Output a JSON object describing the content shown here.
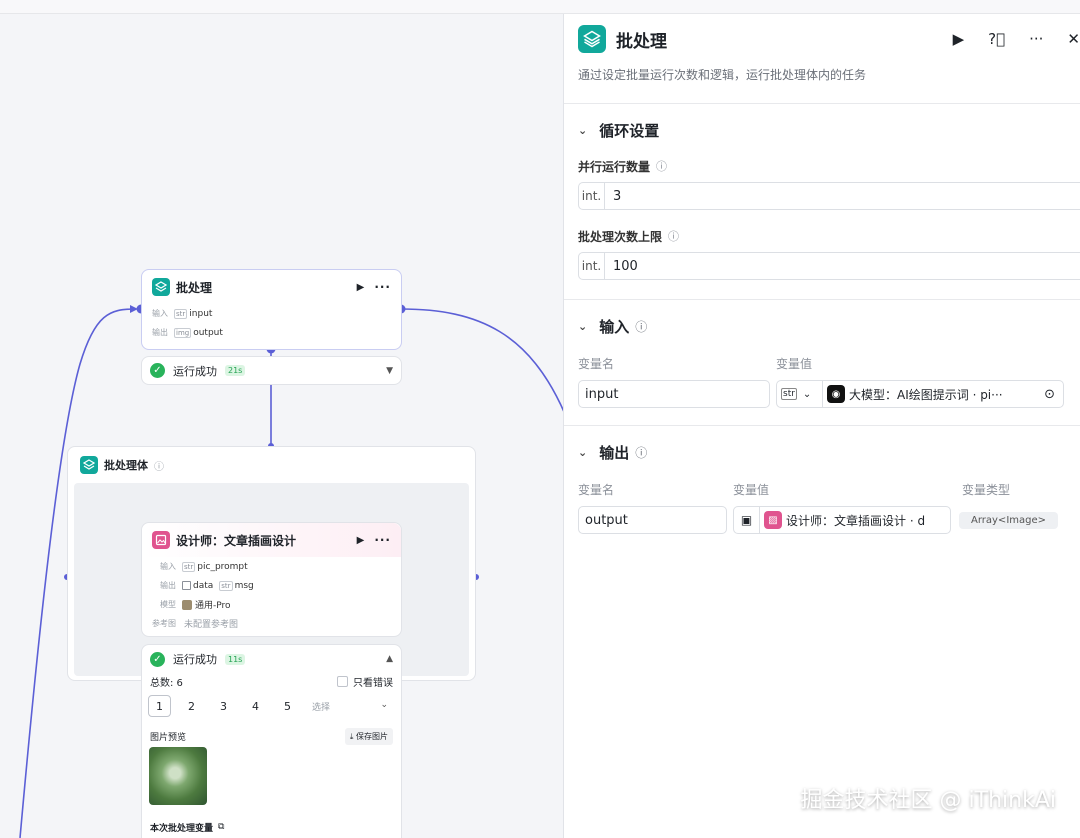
{
  "colors": {
    "accent": "#11a89b",
    "wire": "#5b5fd6",
    "success": "#29b35b",
    "designer": "#e0548f"
  },
  "batch_node": {
    "title": "批处理",
    "input_key": "输入",
    "input_type": "str",
    "input_value": "input",
    "output_key": "输出",
    "output_type": "img",
    "output_value": "output"
  },
  "batch_status": {
    "text": "运行成功",
    "time": "21s"
  },
  "batch_body": {
    "title": "批处理体"
  },
  "designer_node": {
    "title": "设计师：文章插画设计",
    "input_key": "输入",
    "input_type": "str",
    "input_value": "pic_prompt",
    "output_key": "输出",
    "output_value1": "data",
    "output_type2": "str",
    "output_value2": "msg",
    "model_key": "模型",
    "model_value": "通用-Pro",
    "ref_key": "参考图",
    "ref_value": "未配置参考图"
  },
  "designer_status": {
    "text": "运行成功",
    "time": "11s",
    "total": "总数: 6",
    "errors_only": "只看错误",
    "pages": [
      "1",
      "2",
      "3",
      "4",
      "5"
    ],
    "select_placeholder": "选择",
    "preview_label": "图片预览",
    "save_label": "保存图片",
    "vars_label": "本次批处理变量"
  },
  "panel": {
    "title": "批处理",
    "description": "通过设定批量运行次数和逻辑，运行批处理体内的任务",
    "loop": {
      "title": "循环设置",
      "parallel_label": "并行运行数量",
      "parallel_type": "int.",
      "parallel_value": "3",
      "max_label": "批处理次数上限",
      "max_type": "int.",
      "max_value": "100"
    },
    "input": {
      "title": "输入",
      "col_name": "变量名",
      "col_value": "变量值",
      "var_name": "input",
      "var_type": "str",
      "ref_text": "大模型：AI绘图提示词 · pi···"
    },
    "output": {
      "title": "输出",
      "col_name": "变量名",
      "col_value": "变量值",
      "col_type": "变量类型",
      "var_name": "output",
      "ref_text": "设计师：文章插画设计 · d",
      "type_value": "Array<Image>"
    }
  },
  "watermark": "掘金技术社区 @ iThinkAi"
}
